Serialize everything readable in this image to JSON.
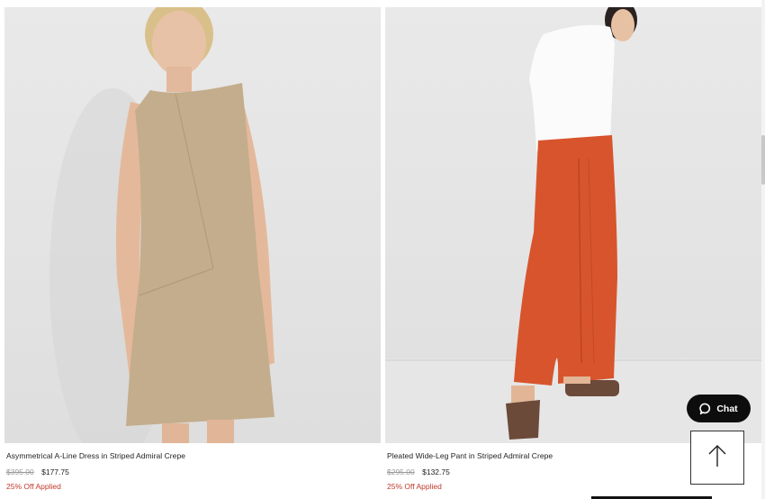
{
  "products": [
    {
      "name": "Asymmetrical A-Line Dress in Striped Admiral Crepe",
      "original_price": "$395.00",
      "sale_price": "$177.75",
      "discount_note": "25% Off Applied"
    },
    {
      "name": "Pleated Wide-Leg Pant in Striped Admiral Crepe",
      "original_price": "$295.00",
      "sale_price": "$132.75",
      "discount_note": "25% Off Applied"
    }
  ],
  "chat": {
    "label": "Chat",
    "icon": "chat-bubble-icon"
  },
  "scroll_top": {
    "icon": "arrow-up-icon"
  },
  "colors": {
    "discount": "#c0392b",
    "strike_price": "#9a9a9a",
    "chat_bg": "#0d0d0d",
    "dress": "#c4ad8c",
    "pant": "#d8542d"
  }
}
